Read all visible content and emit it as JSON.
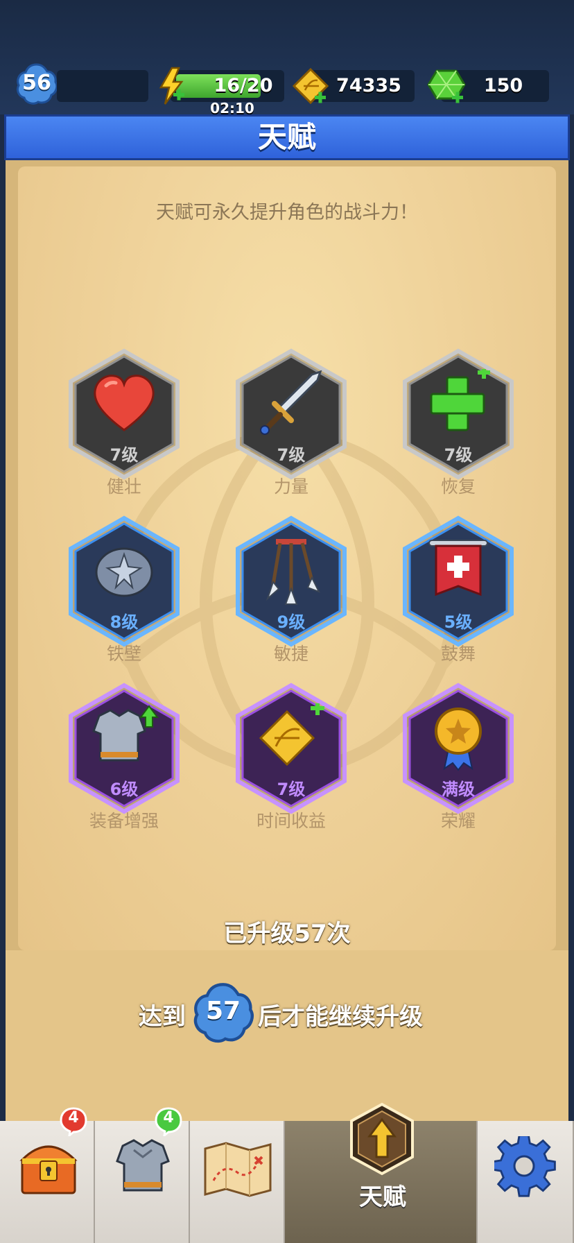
{
  "header": {
    "player_level": "56",
    "energy": "16/20",
    "energy_timer": "02:10",
    "gold": "74335",
    "gems": "150"
  },
  "title": "天赋",
  "subtitle": "天赋可永久提升角色的战斗力！",
  "talents": [
    {
      "name": "健壮",
      "level": "7级",
      "tier": "gray",
      "icon": "heart-icon"
    },
    {
      "name": "力量",
      "level": "7级",
      "tier": "gray",
      "icon": "sword-icon"
    },
    {
      "name": "恢复",
      "level": "7级",
      "tier": "gray",
      "icon": "heal-plus-icon"
    },
    {
      "name": "铁壁",
      "level": "8级",
      "tier": "blue",
      "icon": "spiked-shield-icon"
    },
    {
      "name": "敏捷",
      "level": "9级",
      "tier": "blue",
      "icon": "arrows-icon"
    },
    {
      "name": "鼓舞",
      "level": "5级",
      "tier": "blue",
      "icon": "banner-icon"
    },
    {
      "name": "装备增强",
      "level": "6级",
      "tier": "purple",
      "icon": "armor-upgrade-icon"
    },
    {
      "name": "时间收益",
      "level": "7级",
      "tier": "purple",
      "icon": "gold-bow-plus-icon"
    },
    {
      "name": "荣耀",
      "level": "满级",
      "tier": "purple",
      "icon": "medal-icon"
    }
  ],
  "upgrade_count_text": "已升级57次",
  "requirement": {
    "prefix": "达到",
    "level": "57",
    "suffix": "后才能继续升级"
  },
  "nav": {
    "tabs": [
      {
        "name": "chest",
        "badge": "4"
      },
      {
        "name": "equipment",
        "badge": "4"
      },
      {
        "name": "map"
      },
      {
        "name": "talent",
        "label": "天赋"
      },
      {
        "name": "settings"
      }
    ]
  },
  "colors": {
    "tier_gray": "#3a3a3a",
    "tier_blue": "#2a3a5a",
    "tier_purple": "#3d2355",
    "banner_blue": "#3b74e8"
  }
}
